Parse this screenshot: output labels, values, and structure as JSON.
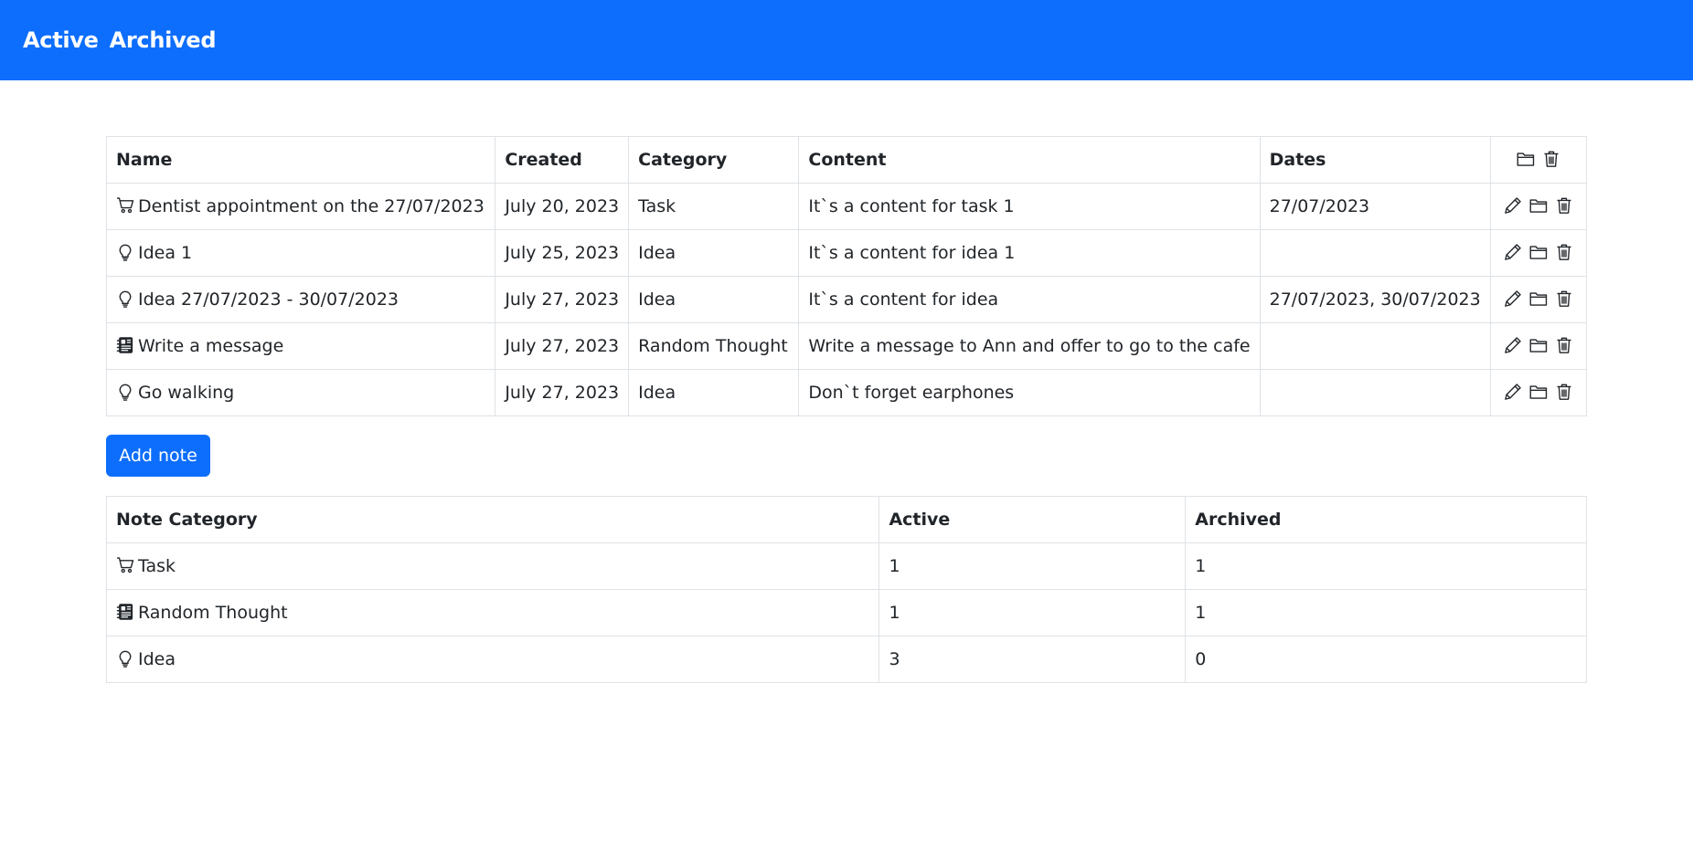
{
  "nav": {
    "active_label": "Active",
    "archived_label": "Archived"
  },
  "notes_table": {
    "headers": {
      "name": "Name",
      "created": "Created",
      "category": "Category",
      "content": "Content",
      "dates": "Dates"
    },
    "rows": [
      {
        "icon": "cart-icon",
        "name": "Dentist appointment on the 27/07/2023",
        "created": "July 20, 2023",
        "category": "Task",
        "content": "It`s a content for task 1",
        "dates": "27/07/2023"
      },
      {
        "icon": "lightbulb-icon",
        "name": "Idea 1",
        "created": "July 25, 2023",
        "category": "Idea",
        "content": "It`s a content for idea 1",
        "dates": ""
      },
      {
        "icon": "lightbulb-icon",
        "name": "Idea 27/07/2023 - 30/07/2023",
        "created": "July 27, 2023",
        "category": "Idea",
        "content": "It`s a content for idea",
        "dates": "27/07/2023, 30/07/2023"
      },
      {
        "icon": "journal-icon",
        "name": "Write a message",
        "created": "July 27, 2023",
        "category": "Random Thought",
        "content": "Write a message to Ann and offer to go to the cafe",
        "dates": ""
      },
      {
        "icon": "lightbulb-icon",
        "name": "Go walking",
        "created": "July 27, 2023",
        "category": "Idea",
        "content": "Don`t forget earphones",
        "dates": ""
      }
    ]
  },
  "add_button": {
    "label": "Add note"
  },
  "stats_table": {
    "headers": {
      "category": "Note Category",
      "active": "Active",
      "archived": "Archived"
    },
    "rows": [
      {
        "icon": "cart-icon",
        "category": "Task",
        "active": "1",
        "archived": "1"
      },
      {
        "icon": "journal-icon",
        "category": "Random Thought",
        "active": "1",
        "archived": "1"
      },
      {
        "icon": "lightbulb-icon",
        "category": "Idea",
        "active": "3",
        "archived": "0"
      }
    ]
  },
  "colors": {
    "primary": "#0d6efd",
    "border": "#dee2e6",
    "text": "#212529"
  }
}
